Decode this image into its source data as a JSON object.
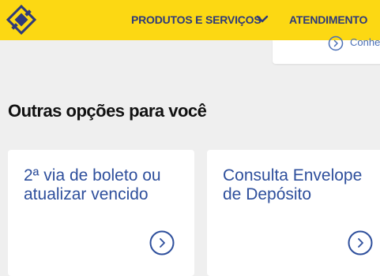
{
  "header": {
    "logo_icon": "banco-do-brasil-logo-icon",
    "nav": {
      "products": "PRODUTOS E SERVIÇOS",
      "attendance": "ATENDIMENTO"
    },
    "brand_color": "#fcd813",
    "nav_color": "#2e3a7a"
  },
  "top_card": {
    "link_text": "Conhe",
    "icon": "chevron-right-circle-icon"
  },
  "section": {
    "title": "Outras opções para você"
  },
  "cards": [
    {
      "title": "2ª via de boleto ou atualizar vencido",
      "icon": "chevron-right-circle-icon"
    },
    {
      "title": "Consulta Envelope de Depósito",
      "icon": "chevron-right-circle-icon"
    }
  ],
  "colors": {
    "accent": "#2e4f9c",
    "background": "#efefef",
    "card": "#ffffff"
  }
}
